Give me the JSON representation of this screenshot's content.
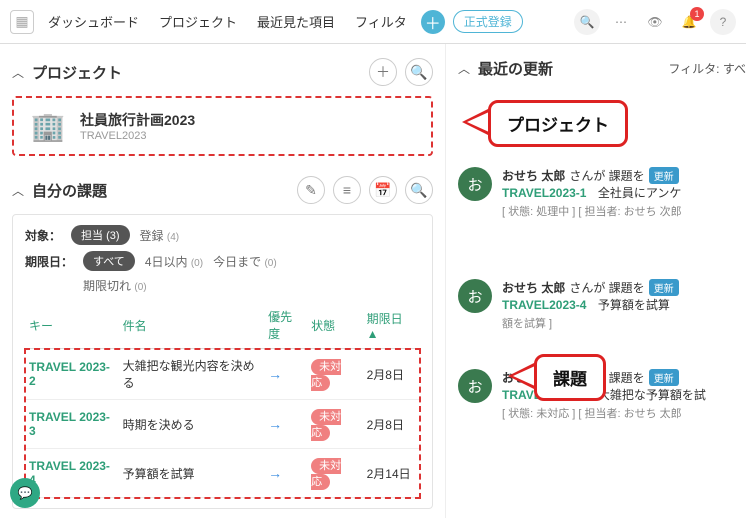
{
  "nav": {
    "items": [
      "ダッシュボード",
      "プロジェクト",
      "最近見た項目",
      "フィルタ"
    ],
    "register": "正式登録",
    "notif_count": "1"
  },
  "projects": {
    "title": "プロジェクト",
    "card": {
      "name": "社員旅行計画2023",
      "key": "TRAVEL2023"
    }
  },
  "my_tasks": {
    "title": "自分の課題",
    "filter1": {
      "label": "対象：",
      "active": "担当",
      "active_count": "(3)",
      "opt": "登録",
      "opt_count": "(4)"
    },
    "filter2": {
      "label": "期限日：",
      "active": "すべて",
      "opt1": "4日以内",
      "opt1_count": "(0)",
      "opt2": "今日まで",
      "opt2_count": "(0)",
      "opt3": "期限切れ",
      "opt3_count": "(0)"
    },
    "headers": {
      "key": "キー",
      "subject": "件名",
      "priority": "優先度",
      "status": "状態",
      "due": "期限日 ▲"
    },
    "rows": [
      {
        "key": "TRAVEL 2023-2",
        "subject": "大雑把な観光内容を決める",
        "status": "未対応",
        "due": "2月8日"
      },
      {
        "key": "TRAVEL 2023-3",
        "subject": "時期を決める",
        "status": "未対応",
        "due": "2月8日"
      },
      {
        "key": "TRAVEL 2023-4",
        "subject": "予算額を試算",
        "status": "未対応",
        "due": "2月14日"
      }
    ]
  },
  "recent": {
    "title": "最近の更新",
    "filter_label": "フィルタ: すべ",
    "items": [
      {
        "avatar": "お",
        "user": "おせち 太郎",
        "action": "さんが 課題を",
        "badge": "更新",
        "key": "TRAVEL2023-1",
        "subject": "全社員にアンケ",
        "meta": "[ 状態: 処理中 ] [ 担当者: おせち 次郎"
      },
      {
        "avatar": "お",
        "user": "おせち 太郎",
        "action": "さんが 課題を",
        "badge": "更新",
        "key": "TRAVEL2023-4",
        "subject": "予算額を試算",
        "meta": "額を試算 ]"
      },
      {
        "avatar": "お",
        "user": "おせち 太郎",
        "action": "さんが 課題を",
        "badge": "更新",
        "key": "TRAVEL2023-4",
        "subject": "大雑把な予算額を試",
        "meta": "[ 状態: 未対応 ] [ 担当者: おせち 太郎"
      }
    ]
  },
  "callouts": {
    "project": "プロジェクト",
    "issue": "課題"
  }
}
